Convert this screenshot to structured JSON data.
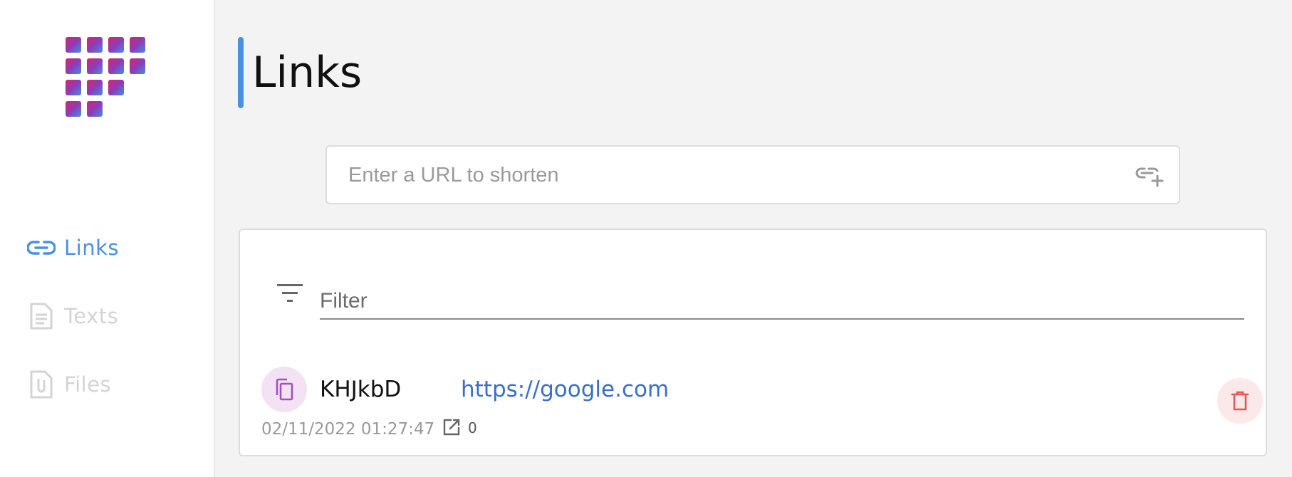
{
  "sidebar": {
    "items": [
      {
        "label": "Links",
        "icon": "link-icon",
        "active": true
      },
      {
        "label": "Texts",
        "icon": "document-icon",
        "active": false
      },
      {
        "label": "Files",
        "icon": "paperclip-icon",
        "active": false
      }
    ]
  },
  "main": {
    "title": "Links",
    "url_input": {
      "placeholder": "Enter a URL to shorten",
      "value": ""
    },
    "filter": {
      "placeholder": "Filter",
      "value": ""
    },
    "links": [
      {
        "short_code": "KHJkbD",
        "url": "https://google.com",
        "created": "02/11/2022 01:27:47",
        "visits": "0"
      }
    ]
  },
  "colors": {
    "accent": "#4a90e2",
    "link": "#3a6fc9",
    "copy_bg": "#f2e2f3",
    "delete_bg": "#fbe8e8",
    "delete_icon": "#e05a5a"
  }
}
